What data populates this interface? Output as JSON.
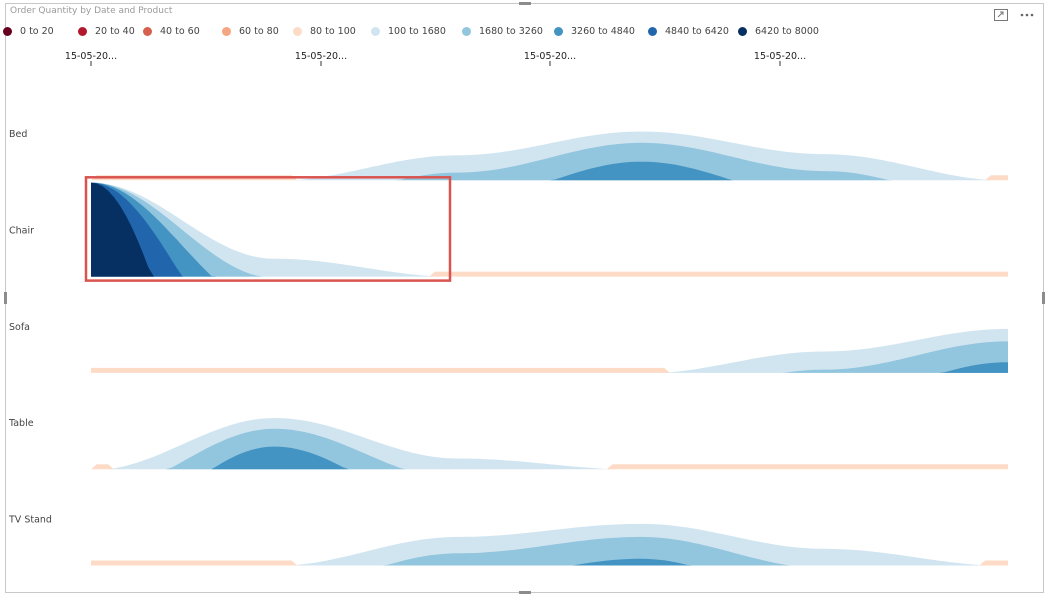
{
  "visual": {
    "title": "Order Quantity by Date and Product",
    "focus_mode_icon": "focus-mode-icon",
    "more_options_icon": "more-options-icon"
  },
  "chart_data": {
    "type": "area",
    "subtype": "stream-ribbon",
    "title": "Order Quantity by Date and Product",
    "x_tick_labels": [
      "15-05-20...",
      "15-05-20...",
      "15-05-20...",
      "15-05-20..."
    ],
    "categories": [
      "Bed",
      "Chair",
      "Sofa",
      "Table",
      "TV Stand"
    ],
    "legend": {
      "position": "top-left",
      "bands": [
        {
          "label": "0 to 20",
          "color": "#67001f"
        },
        {
          "label": "20 to 40",
          "color": "#b2182b"
        },
        {
          "label": "40 to 60",
          "color": "#d6604d"
        },
        {
          "label": "60 to 80",
          "color": "#f4a582"
        },
        {
          "label": "80 to 100",
          "color": "#fddbc7"
        },
        {
          "label": "100 to 1680",
          "color": "#d1e5f0"
        },
        {
          "label": "1680 to 3260",
          "color": "#92c5de"
        },
        {
          "label": "3260 to 4840",
          "color": "#4393c3"
        },
        {
          "label": "4840 to 6420",
          "color": "#2166ac"
        },
        {
          "label": "6420 to 8000",
          "color": "#053061"
        }
      ]
    },
    "series": [
      {
        "name": "Bed",
        "values": [
          0,
          40,
          2200,
          4200,
          2300,
          60
        ]
      },
      {
        "name": "Chair",
        "values": [
          8000,
          1600,
          60,
          60,
          60,
          60
        ]
      },
      {
        "name": "Sofa",
        "values": [
          60,
          60,
          60,
          40,
          1900,
          3800
        ]
      },
      {
        "name": "Table",
        "values": [
          0,
          4400,
          1000,
          40,
          60,
          60
        ]
      },
      {
        "name": "TV Stand",
        "values": [
          60,
          60,
          2500,
          3600,
          1500,
          60
        ]
      }
    ],
    "highlight": {
      "category": "Chair",
      "label": "",
      "color": "#d9534f"
    }
  }
}
